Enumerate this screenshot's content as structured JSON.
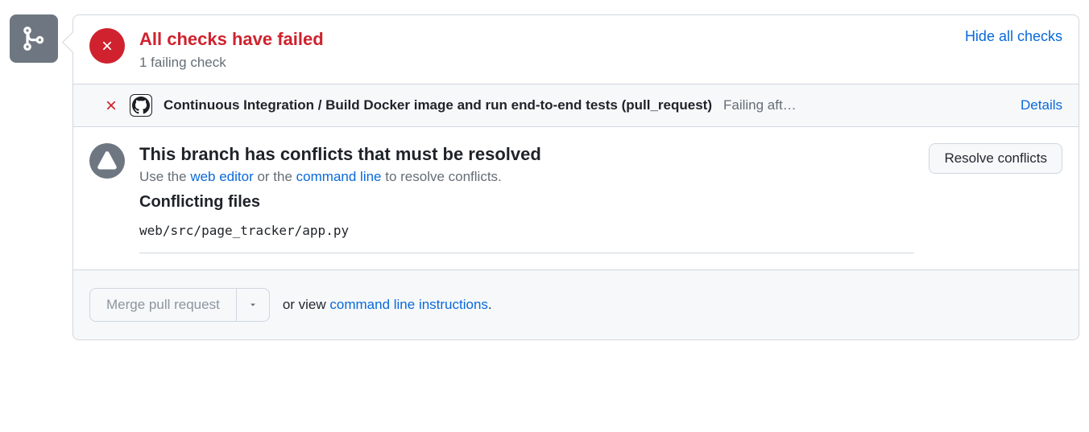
{
  "checks": {
    "title": "All checks have failed",
    "subtitle": "1 failing check",
    "hideLink": "Hide all checks",
    "items": [
      {
        "name": "Continuous Integration / Build Docker image and run end-to-end tests (pull_request)",
        "status": "Failing aft…",
        "detailsLabel": "Details"
      }
    ]
  },
  "conflict": {
    "title": "This branch has conflicts that must be resolved",
    "prefix": "Use the ",
    "webEditor": "web editor",
    "middle": " or the ",
    "commandLine": "command line",
    "suffix": " to resolve conflicts.",
    "filesTitle": "Conflicting files",
    "files": [
      "web/src/page_tracker/app.py"
    ],
    "resolveBtn": "Resolve conflicts"
  },
  "footer": {
    "mergeBtn": "Merge pull request",
    "orView": "or view ",
    "cliLink": "command line instructions",
    "period": "."
  }
}
